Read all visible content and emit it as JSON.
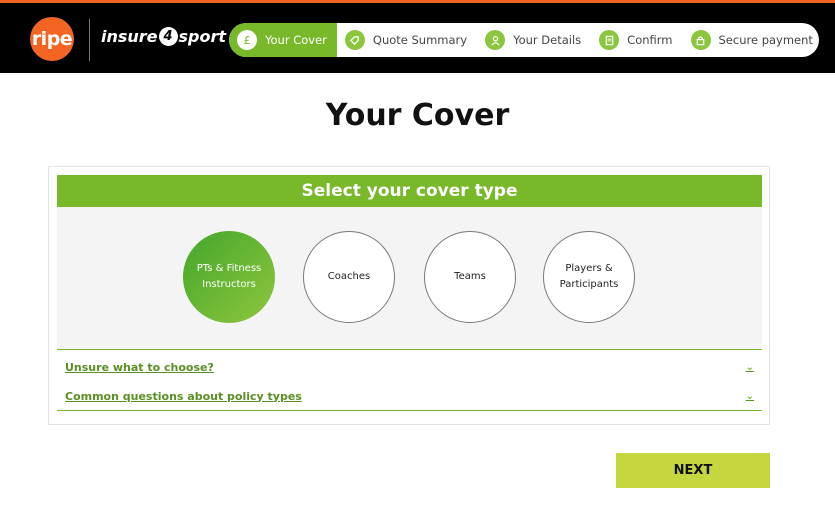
{
  "header": {
    "logo_text": "ripe",
    "brand_pre": "insure",
    "brand_mid": "4",
    "brand_post": "sport",
    "accent_color": "#f26522",
    "steps": [
      {
        "label": "Your Cover",
        "icon": "pound-icon",
        "active": true
      },
      {
        "label": "Quote Summary",
        "icon": "tag-icon",
        "active": false
      },
      {
        "label": "Your Details",
        "icon": "user-icon",
        "active": false
      },
      {
        "label": "Confirm",
        "icon": "document-icon",
        "active": false
      },
      {
        "label": "Secure payment",
        "icon": "lock-icon",
        "active": false
      }
    ]
  },
  "page": {
    "title": "Your Cover"
  },
  "cover_select": {
    "heading": "Select your cover type",
    "brand_green": "#78b829",
    "options": [
      {
        "label": "PTs & Fitness Instructors",
        "selected": true
      },
      {
        "label": "Coaches",
        "selected": false
      },
      {
        "label": "Teams",
        "selected": false
      },
      {
        "label": "Players & Participants",
        "selected": false
      }
    ],
    "faqs": [
      {
        "label": "Unsure what to choose?"
      },
      {
        "label": "Common questions about policy types"
      }
    ]
  },
  "actions": {
    "next_label": "NEXT",
    "next_color": "#c6d63f"
  }
}
